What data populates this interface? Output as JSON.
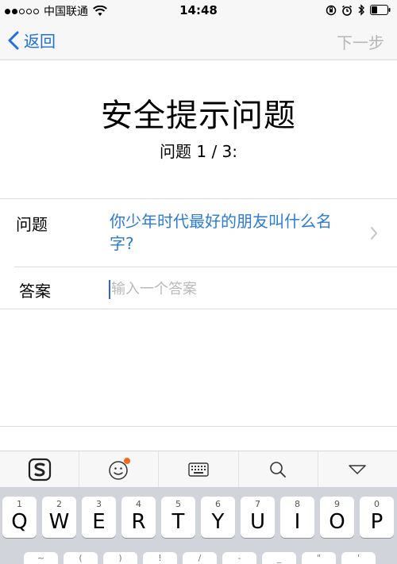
{
  "status_bar": {
    "carrier": "中国联通",
    "time": "14:48"
  },
  "nav": {
    "back_label": "返回",
    "next_label": "下一步"
  },
  "page": {
    "title": "安全提示问题",
    "subtitle": "问题 1 / 3:"
  },
  "form": {
    "question_label": "问题",
    "question_value": "你少年时代最好的朋友叫什么名字?",
    "answer_label": "答案",
    "answer_placeholder": "输入一个答案",
    "answer_value": ""
  },
  "toolbar": {
    "items": [
      "sogou-logo-icon",
      "emoji-icon",
      "keyboard-icon",
      "search-icon",
      "collapse-icon"
    ],
    "accent": "#f26b1d"
  },
  "keyboard": {
    "row1": [
      {
        "letter": "Q",
        "hint": "1"
      },
      {
        "letter": "W",
        "hint": "2"
      },
      {
        "letter": "E",
        "hint": "3"
      },
      {
        "letter": "R",
        "hint": "4"
      },
      {
        "letter": "T",
        "hint": "5"
      },
      {
        "letter": "Y",
        "hint": "6"
      },
      {
        "letter": "U",
        "hint": "7"
      },
      {
        "letter": "I",
        "hint": "8"
      },
      {
        "letter": "O",
        "hint": "9"
      },
      {
        "letter": "P",
        "hint": "0"
      }
    ],
    "row2_hints": [
      "~",
      "(",
      ")",
      "!",
      "/",
      "-",
      "_",
      "\"",
      "'"
    ]
  },
  "colors": {
    "link_blue": "#1f6fe0",
    "question_blue": "#2c7bd6",
    "disabled_gray": "#b5b5b5"
  }
}
